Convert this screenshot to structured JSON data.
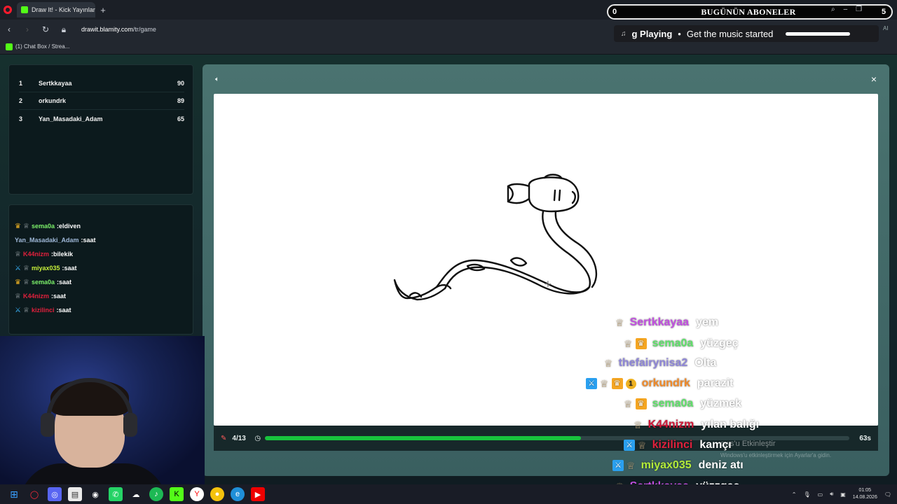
{
  "browser": {
    "tab_title": "Draw It! - Kick Yayınları İç",
    "new_tab": "+",
    "url_host": "drawit.blamity.com",
    "url_path": "/tr/game",
    "bookmark": "(1) Chat Box / Strea..."
  },
  "overlay_top": {
    "count": "0",
    "title": "BUGÜNÜN ABONELER",
    "right": "5"
  },
  "now_playing": {
    "prefix": "g Playing",
    "separator": "•",
    "track": "Get the music started",
    "ai": "AI"
  },
  "leaderboard": [
    {
      "rank": "1",
      "name": "Sertkkayaa",
      "score": "90"
    },
    {
      "rank": "2",
      "name": "orkundrk",
      "score": "89"
    },
    {
      "rank": "3",
      "name": "Yan_Masadaki_Adam",
      "score": "65"
    }
  ],
  "side_chat": [
    {
      "icons": [
        "crown",
        "mod"
      ],
      "user": "sema0a",
      "color": "#7cf06a",
      "msg": "eldiven"
    },
    {
      "icons": [],
      "user": "Yan_Masadaki_Adam",
      "color": "#9fb8d8",
      "msg": "saat"
    },
    {
      "icons": [
        "mod"
      ],
      "user": "K44nizm",
      "color": "#e0203c",
      "msg": "bilekik"
    },
    {
      "icons": [
        "sword",
        "mod"
      ],
      "user": "miyax035",
      "color": "#c7f03a",
      "msg": "saat"
    },
    {
      "icons": [
        "crown",
        "mod"
      ],
      "user": "sema0a",
      "color": "#7cf06a",
      "msg": "saat"
    },
    {
      "icons": [
        "mod"
      ],
      "user": "K44nizm",
      "color": "#e0203c",
      "msg": "saat"
    },
    {
      "icons": [
        "sword",
        "mod"
      ],
      "user": "kizilinci",
      "color": "#e0203c",
      "msg": "saat"
    }
  ],
  "game": {
    "round": "4/13",
    "time": "63s",
    "progress": 0.54,
    "close": "×"
  },
  "overlay_chat": [
    {
      "user": "Sertkkayaa",
      "color": "#c14fe0",
      "msg": "yem"
    },
    {
      "user": "sema0a",
      "color": "#5fe06a",
      "msg": "yüzgeç"
    },
    {
      "user": "thefairynisa2",
      "color": "#8e86d8",
      "msg": "Olta"
    },
    {
      "user": "orkundrk",
      "color": "#f08a28",
      "msg": "parazit",
      "badge_num": "1"
    },
    {
      "user": "sema0a",
      "color": "#5fe06a",
      "msg": "yüzmek"
    },
    {
      "user": "K44nizm",
      "color": "#d01838",
      "msg": "yılan balığı"
    },
    {
      "user": "kizilinci",
      "color": "#e0203c",
      "msg": "kamçı"
    },
    {
      "user": "miyax035",
      "color": "#b4ec3a",
      "msg": "deniz atı"
    },
    {
      "user": "Sertkkayaa",
      "color": "#c14fe0",
      "msg": "yüzzgeç"
    }
  ],
  "windows_watermark": {
    "line1": "ows'u Etkinleştir",
    "line2": "Windows'u etkinleştirmek için Ayarlar'a gidin."
  },
  "taskbar": {
    "time": "01:05",
    "date": "14.08.2026"
  }
}
